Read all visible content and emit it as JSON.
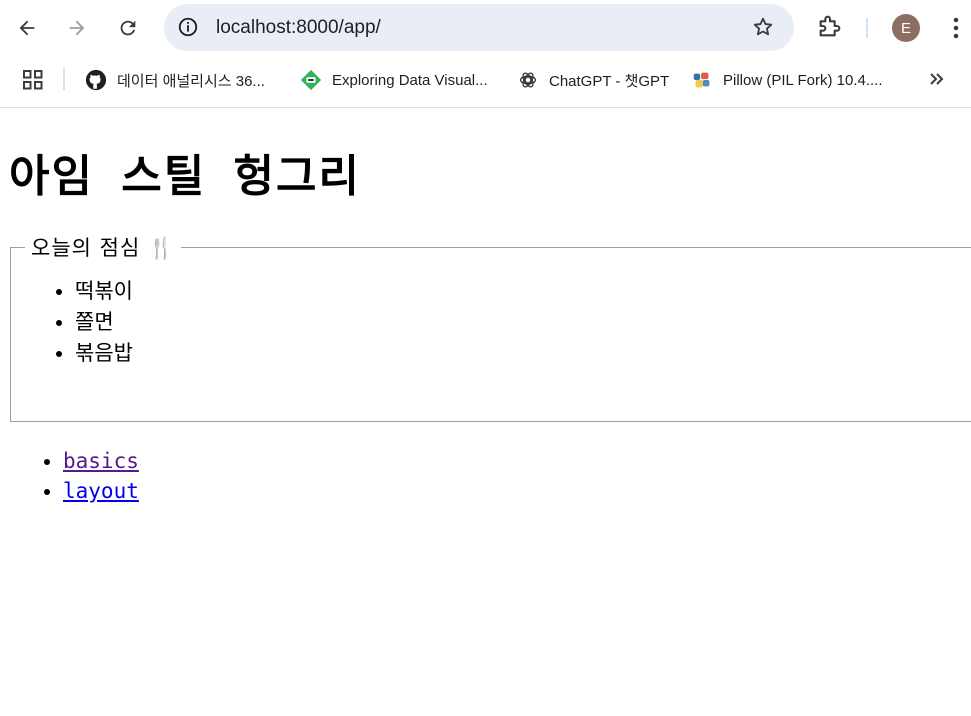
{
  "browser": {
    "url": "localhost:8000/app/",
    "profile_initial": "E",
    "bookmarks": [
      {
        "label": "데이터 애널리시스 36...",
        "icon": "github-icon"
      },
      {
        "label": "Exploring Data Visual...",
        "icon": "datacamp-icon"
      },
      {
        "label": "ChatGPT - 챗GPT",
        "icon": "openai-icon"
      },
      {
        "label": "Pillow (PIL Fork) 10.4....",
        "icon": "pillow-icon"
      }
    ]
  },
  "page": {
    "title": "아임 스틸 헝그리",
    "snack_legend": "오늘의 점심",
    "snack_icon": "🍴",
    "snacks": [
      "떡볶이",
      "쫄면",
      "볶음밥"
    ],
    "links": [
      {
        "label": "basics",
        "visited": true
      },
      {
        "label": "layout",
        "visited": false
      }
    ]
  },
  "colors": {
    "omnibox_bg": "#e9eef6",
    "avatar_bg": "#8d6e63",
    "visited_link": "#551a8b",
    "link": "#0000ee"
  }
}
